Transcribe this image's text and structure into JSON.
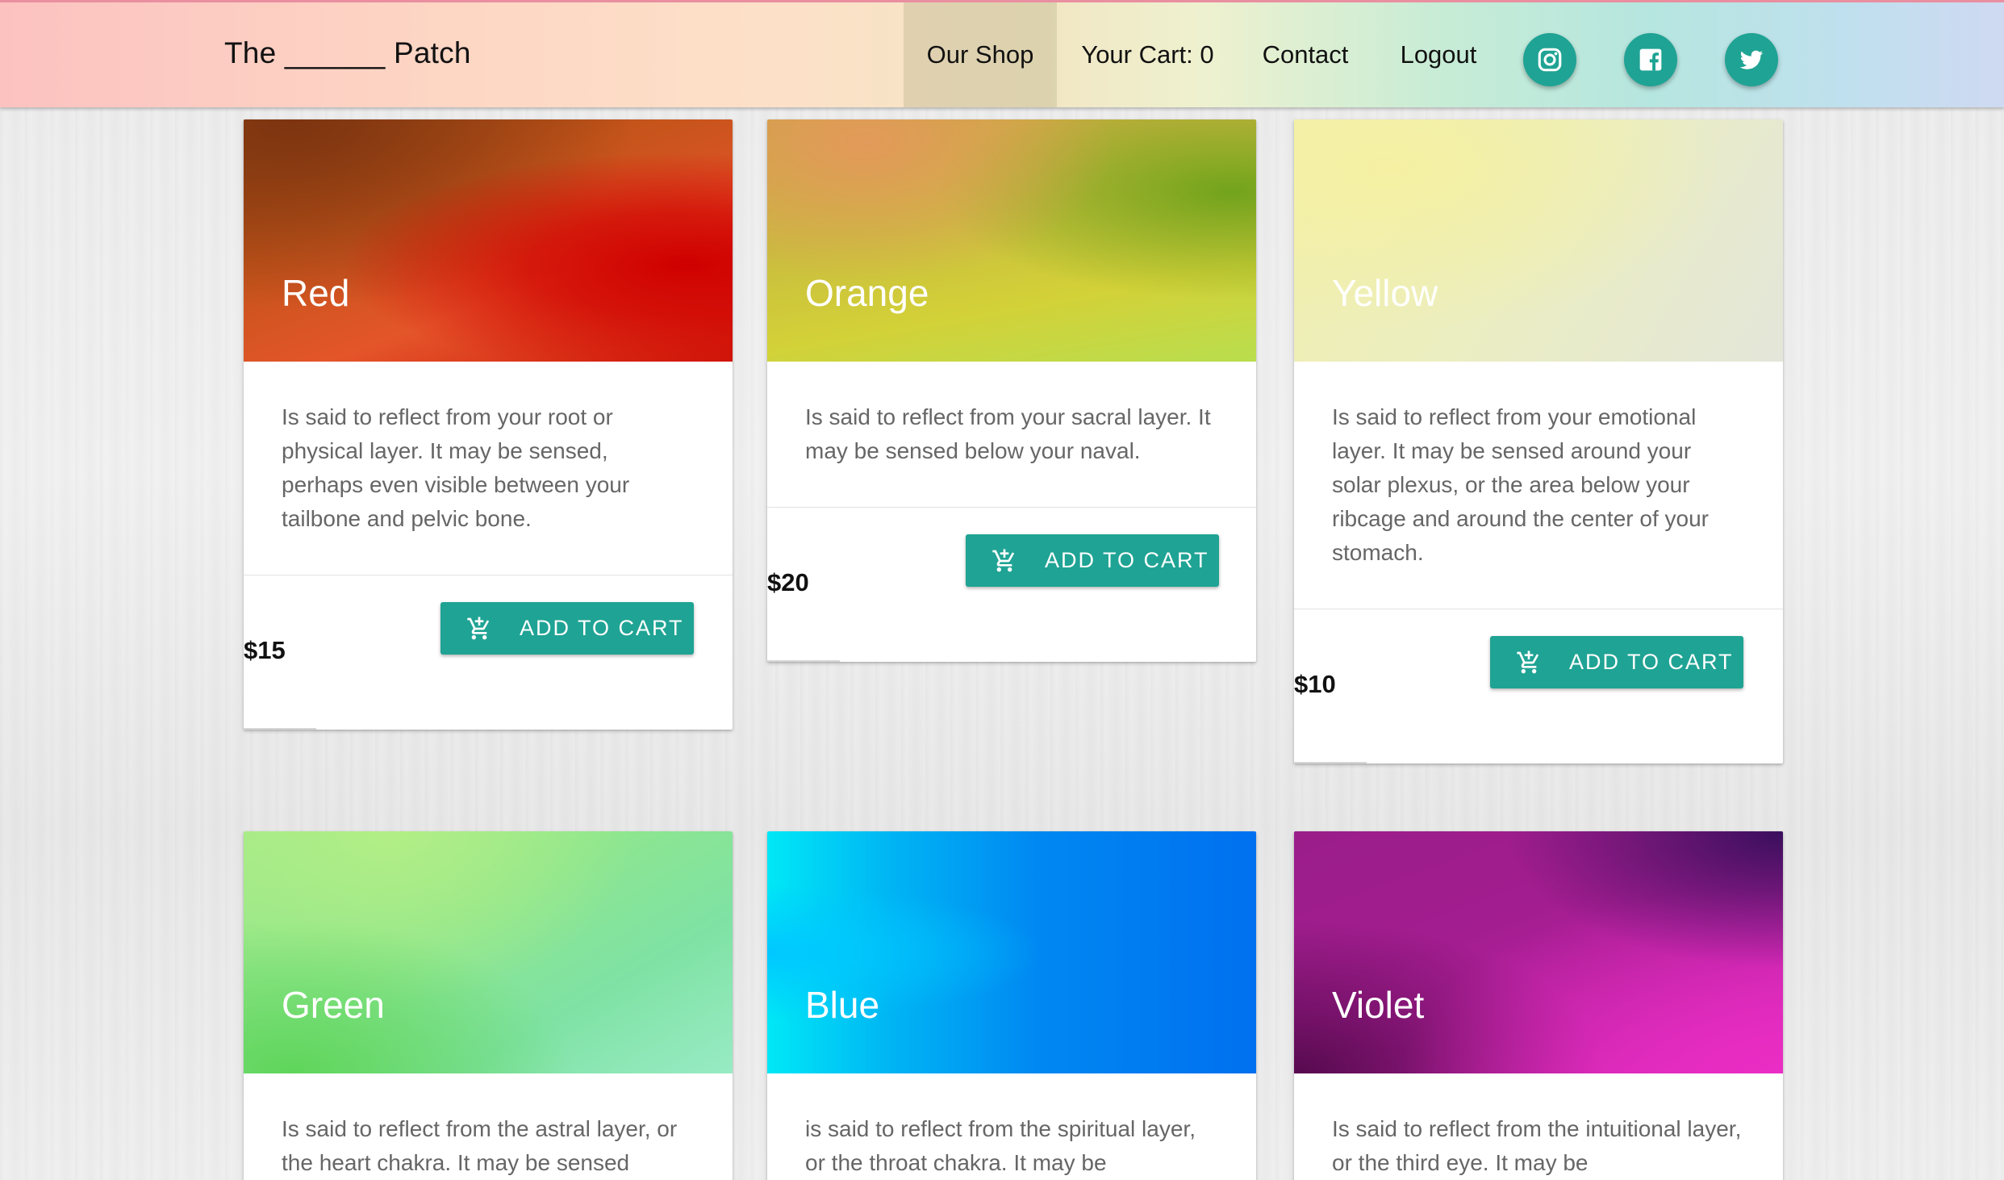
{
  "header": {
    "brand": "The ______ Patch",
    "nav": {
      "shop": "Our Shop",
      "cart": "Your Cart: 0",
      "contact": "Contact",
      "logout": "Logout"
    },
    "social": [
      "instagram-icon",
      "facebook-icon",
      "twitter-icon"
    ]
  },
  "add_to_cart_label": "ADD TO CART",
  "products": [
    {
      "title": "Red",
      "description": "Is said to reflect from your root or physical layer. It may be sensed, perhaps even visible between your tailbone and pelvic bone.",
      "price": "$15"
    },
    {
      "title": "Orange",
      "description": "Is said to reflect from your sacral layer. It may be sensed below your naval.",
      "price": "$20"
    },
    {
      "title": "Yellow",
      "description": "Is said to reflect from your emotional layer. It may be sensed around your solar plexus, or the area below your ribcage and around the center of your stomach.",
      "price": "$10"
    },
    {
      "title": "Green",
      "description": "Is said to reflect from the astral layer, or the heart chakra. It may be sensed"
    },
    {
      "title": "Blue",
      "description": "is said to reflect from the spiritual layer, or the throat chakra. It may be"
    },
    {
      "title": "Violet",
      "description": "Is said to reflect from the intuitional layer, or the third eye. It may be"
    }
  ],
  "colors": {
    "accent": "#1fa394"
  }
}
